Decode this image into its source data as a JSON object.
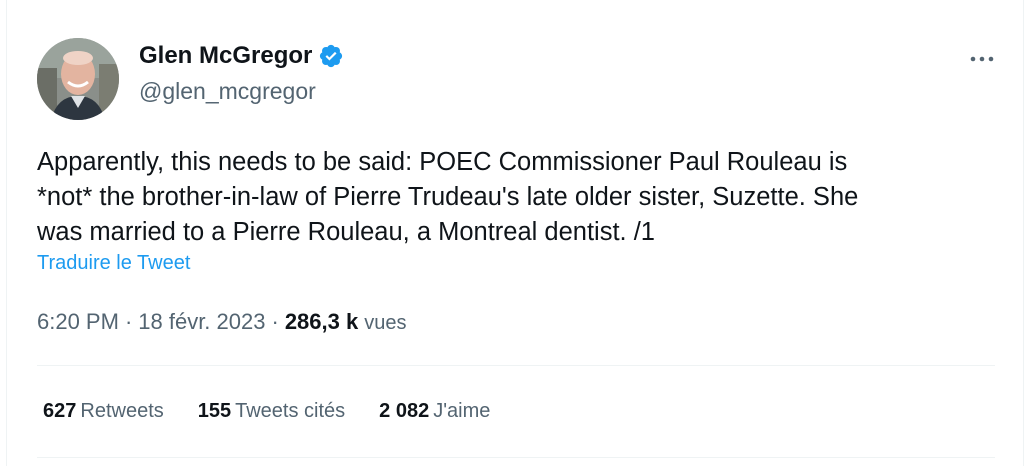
{
  "author": {
    "name": "Glen McGregor",
    "handle": "@glen_mcgregor",
    "verified": true,
    "avatar_icon": "profile-photo"
  },
  "tweet": {
    "text": "Apparently, this needs to be said: POEC Commissioner Paul Rouleau is\n*not* the brother-in-law of Pierre Trudeau's late older sister, Suzette. She\nwas married to a Pierre Rouleau, a Montreal dentist. /1",
    "translate_label": "Traduire le Tweet"
  },
  "meta": {
    "time": "6:20 PM",
    "separator": "·",
    "date": "18 févr. 2023",
    "views_count": "286,3 k",
    "views_label": "vues"
  },
  "stats": {
    "retweets_count": "627",
    "retweets_label": "Retweets",
    "quotes_count": "155",
    "quotes_label": "Tweets cités",
    "likes_count": "2 082",
    "likes_label": "J'aime"
  },
  "more_icon": "more-horizontal-icon",
  "colors": {
    "accent": "#1d9bf0",
    "text": "#0f1419",
    "secondary": "#536471",
    "border": "#eff3f4"
  }
}
